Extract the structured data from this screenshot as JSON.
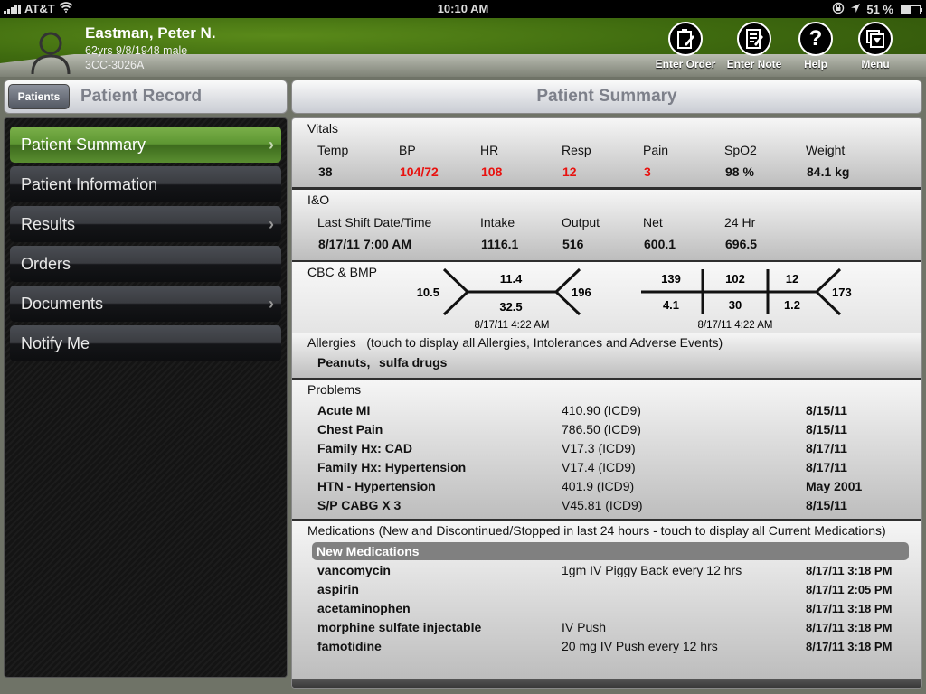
{
  "status_bar": {
    "carrier": "AT&T",
    "time": "10:10 AM",
    "battery_percent_label": "51 %",
    "battery_level": 0.51,
    "icons": [
      "signal-icon",
      "wifi-icon",
      "rotation-lock-icon",
      "location-icon",
      "battery-icon"
    ]
  },
  "patient": {
    "name": "Eastman, Peter N.",
    "demographics": "62yrs 9/8/1948 male",
    "location": "3CC-3026A"
  },
  "header_actions": [
    {
      "label": "Enter Order",
      "icon": "clipboard-pen-icon"
    },
    {
      "label": "Enter Note",
      "icon": "note-pen-icon"
    },
    {
      "label": "Help",
      "icon": "question-icon"
    },
    {
      "label": "Menu",
      "icon": "menu-dropdown-icon"
    }
  ],
  "left_panel": {
    "back_button": "Patients",
    "title": "Patient Record",
    "nav": [
      {
        "label": "Patient Summary",
        "active": true,
        "has_chevron": true
      },
      {
        "label": "Patient Information",
        "active": false,
        "has_chevron": false
      },
      {
        "label": "Results",
        "active": false,
        "has_chevron": true
      },
      {
        "label": "Orders",
        "active": false,
        "has_chevron": false
      },
      {
        "label": "Documents",
        "active": false,
        "has_chevron": true
      },
      {
        "label": "Notify Me",
        "active": false,
        "has_chevron": false
      }
    ]
  },
  "main": {
    "title": "Patient Summary",
    "vitals": {
      "title": "Vitals",
      "items": [
        {
          "label": "Temp",
          "value": "38",
          "abnormal": false
        },
        {
          "label": "BP",
          "value": "104/72",
          "abnormal": true
        },
        {
          "label": "HR",
          "value": "108",
          "abnormal": true
        },
        {
          "label": "Resp",
          "value": "12",
          "abnormal": true
        },
        {
          "label": "Pain",
          "value": "3",
          "abnormal": true
        },
        {
          "label": "SpO2",
          "value": "98 %",
          "abnormal": false
        },
        {
          "label": "Weight",
          "value": "84.1 kg",
          "abnormal": false
        }
      ]
    },
    "io": {
      "title": "I&O",
      "items": [
        {
          "label": "Last Shift Date/Time",
          "value": "8/17/11 7:00 AM"
        },
        {
          "label": "Intake",
          "value": "1116.1"
        },
        {
          "label": "Output",
          "value": "516"
        },
        {
          "label": "Net",
          "value": "600.1"
        },
        {
          "label": "24 Hr",
          "value": "696.5"
        }
      ]
    },
    "labs": {
      "title": "CBC & BMP",
      "cbc": {
        "wbc": "10.5",
        "hgb": "11.4",
        "hct": "32.5",
        "plt": "196",
        "timestamp": "8/17/11 4:22 AM"
      },
      "bmp": {
        "na": "139",
        "cl": "102",
        "bun": "12",
        "k": "4.1",
        "co2": "30",
        "cr": "1.2",
        "glu": "173",
        "timestamp": "8/17/11 4:22 AM"
      }
    },
    "allergies": {
      "title": "Allergies",
      "hint": "(touch to display all Allergies, Intolerances and Adverse Events)",
      "items": [
        "Peanuts,",
        "sulfa drugs"
      ]
    },
    "problems": {
      "title": "Problems",
      "rows": [
        {
          "name": "Acute MI",
          "code": "410.90 (ICD9)",
          "date": "8/15/11"
        },
        {
          "name": "Chest Pain",
          "code": "786.50 (ICD9)",
          "date": "8/15/11"
        },
        {
          "name": "Family Hx: CAD",
          "code": "V17.3 (ICD9)",
          "date": "8/17/11"
        },
        {
          "name": "Family Hx: Hypertension",
          "code": "V17.4 (ICD9)",
          "date": "8/17/11"
        },
        {
          "name": "HTN - Hypertension",
          "code": "401.9 (ICD9)",
          "date": "May 2001"
        },
        {
          "name": "S/P CABG X 3",
          "code": "V45.81 (ICD9)",
          "date": "8/15/11"
        }
      ]
    },
    "medications": {
      "title": "Medications (New and Discontinued/Stopped in last 24 hours - touch to display all Current Medications)",
      "group_label": "New Medications",
      "rows": [
        {
          "name": "vancomycin",
          "instructions": "1gm IV Piggy Back every 12 hrs",
          "datetime": "8/17/11 3:18 PM"
        },
        {
          "name": "aspirin",
          "instructions": "",
          "datetime": "8/17/11 2:05 PM"
        },
        {
          "name": "acetaminophen",
          "instructions": "",
          "datetime": "8/17/11 3:18 PM"
        },
        {
          "name": "morphine sulfate injectable",
          "instructions": "IV Push",
          "datetime": "8/17/11 3:18 PM"
        },
        {
          "name": "famotidine",
          "instructions": "20 mg IV Push every 12 hrs",
          "datetime": "8/17/11 3:18 PM"
        }
      ]
    }
  }
}
